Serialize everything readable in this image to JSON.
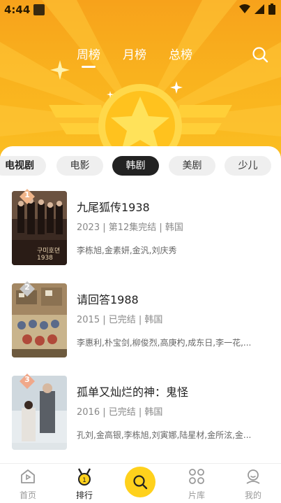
{
  "status": {
    "time": "4:44"
  },
  "top_tabs": [
    {
      "label": "周榜"
    },
    {
      "label": "月榜"
    },
    {
      "label": "总榜"
    }
  ],
  "categories": [
    {
      "label": "电视剧"
    },
    {
      "label": "电影"
    },
    {
      "label": "韩剧"
    },
    {
      "label": "美剧"
    },
    {
      "label": "少儿"
    }
  ],
  "items": [
    {
      "rank": "1",
      "title": "九尾狐传1938",
      "meta": "2023 | 第12集完结 | 韩国",
      "cast": "李栋旭,金素妍,金汎,刘庆秀",
      "poster_text": "구미호뎐 1938"
    },
    {
      "rank": "2",
      "title": "请回答1988",
      "meta": "2015 | 已完结 | 韩国",
      "cast": "李惠利,朴宝剑,柳俊烈,高庚杓,成东日,李一花,...",
      "poster_text": ""
    },
    {
      "rank": "3",
      "title": "孤单又灿烂的神：鬼怪",
      "meta": "2016 | 已完结 | 韩国",
      "cast": "孔刘,金高银,李栋旭,刘寅娜,陆星材,金所泫,金...",
      "poster_text": ""
    }
  ],
  "bottom_nav": [
    {
      "label": "首页"
    },
    {
      "label": "排行"
    },
    {
      "label": "片库"
    },
    {
      "label": "我的"
    }
  ],
  "colors": {
    "accent": "#ffd11c",
    "hero_top": "#f7a21b",
    "hero_bottom": "#fbbf22"
  }
}
